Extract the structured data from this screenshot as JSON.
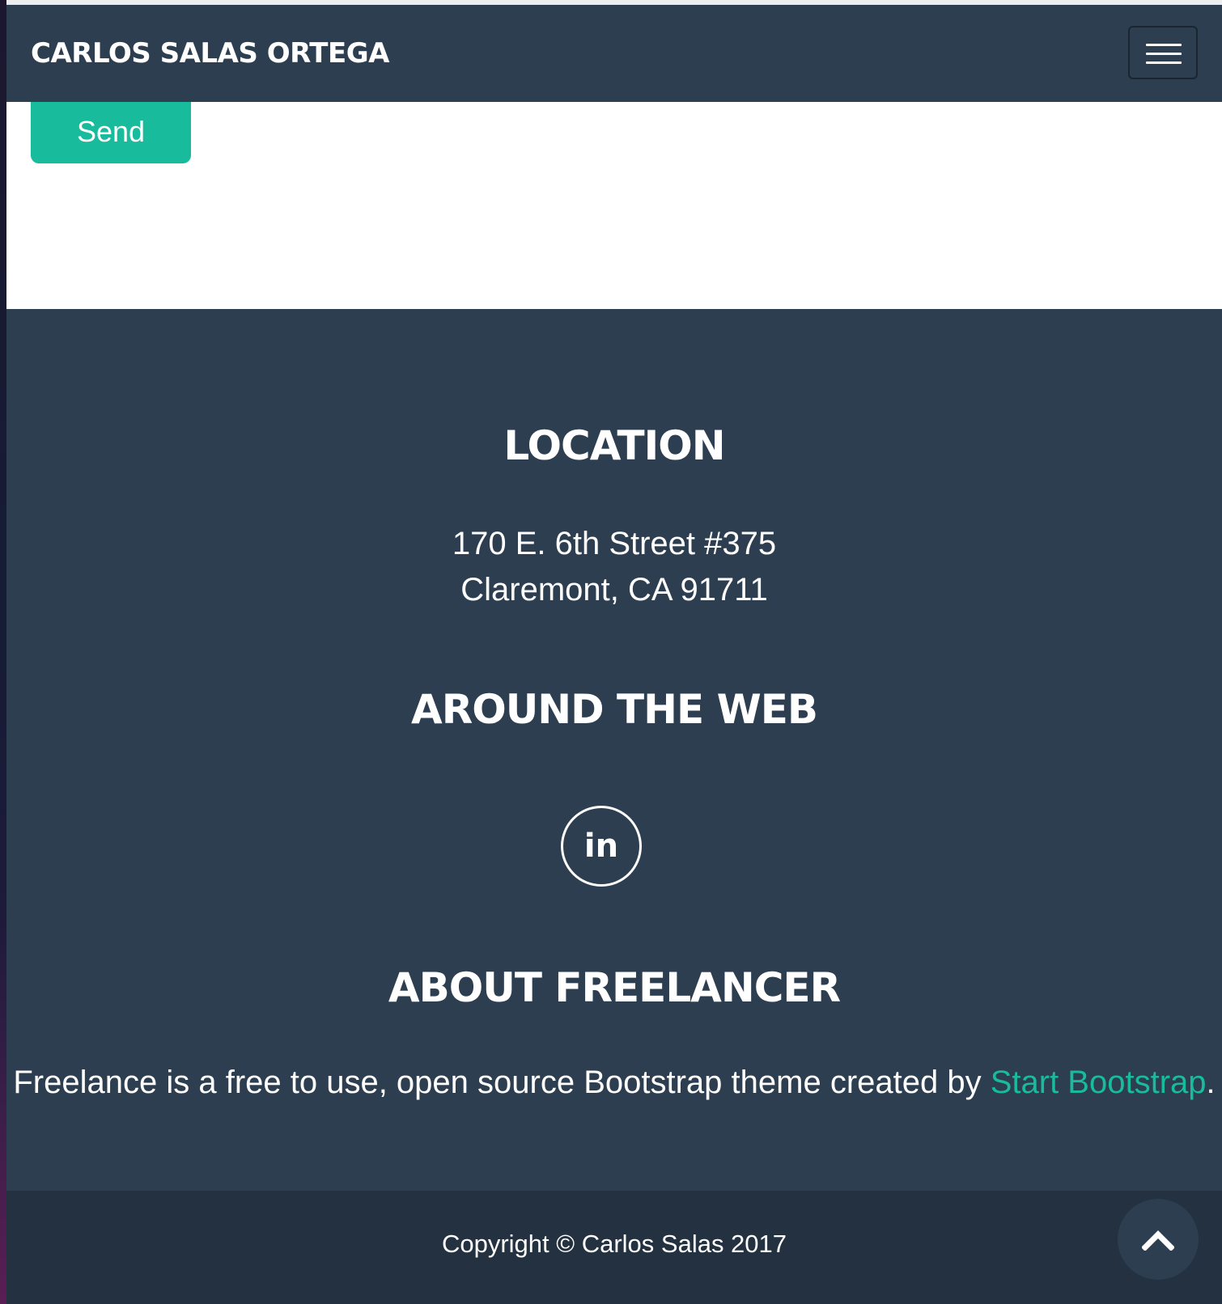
{
  "navbar": {
    "brand": "CARLOS SALAS ORTEGA",
    "menu_icon": "hamburger-menu-icon"
  },
  "contact": {
    "send_label": "Send"
  },
  "footer": {
    "location": {
      "heading": "LOCATION",
      "address_line1": "170 E. 6th Street #375",
      "address_line2": "Claremont, CA 91711"
    },
    "around_the_web": {
      "heading": "AROUND THE WEB",
      "social_links": [
        {
          "icon": "linkedin-icon",
          "glyph": "in"
        }
      ]
    },
    "about": {
      "heading": "ABOUT FREELANCER",
      "text_before_link": "Freelance is a free to use, open source Bootstrap theme created by ",
      "link_text": "Start Bootstrap",
      "text_after_link": "."
    },
    "copyright": "Copyright © Carlos Salas 2017",
    "scroll_top_icon": "chevron-up-icon"
  },
  "colors": {
    "primary": "#2c3e50",
    "footer_dark": "#233140",
    "accent": "#18bc9c",
    "text": "#ffffff"
  }
}
